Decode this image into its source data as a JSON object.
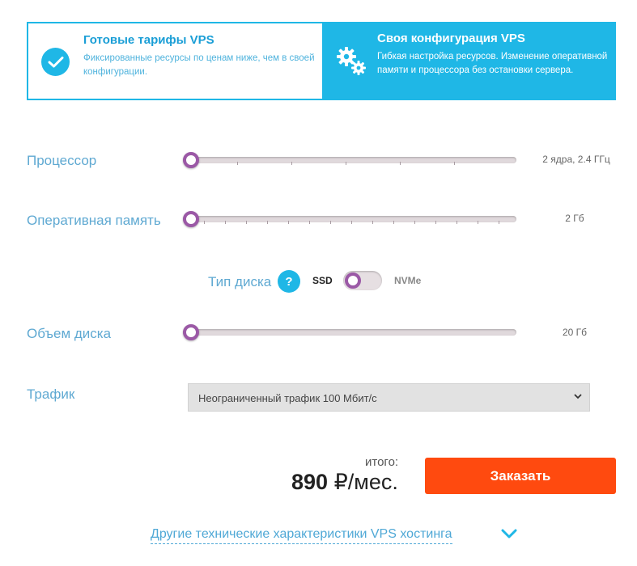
{
  "tabs": {
    "ready": {
      "title": "Готовые тарифы VPS",
      "description": "Фиксированные ресурсы по ценам ниже, чем в своей конфигурации.",
      "icon": "check-circle-icon"
    },
    "custom": {
      "title": "Своя конфигурация VPS",
      "description": "Гибкая настройка ресурсов. Изменение оперативной памяти и процессора без остановки сервера.",
      "icon": "gears-icon"
    }
  },
  "cpu": {
    "label": "Процессор",
    "value": "2 ядра, 2.4 ГГц",
    "level": 0
  },
  "ram": {
    "label": "Оперативная память",
    "value": "2 Гб",
    "level": 0
  },
  "disk_type": {
    "label": "Тип диска",
    "help": "?",
    "option_left": "SSD",
    "option_right": "NVMe",
    "selected": "SSD"
  },
  "disk": {
    "label": "Объем диска",
    "value": "20 Гб",
    "level": 0
  },
  "traffic": {
    "label": "Трафик",
    "selected": "Неограниченный трафик 100 Мбит/с"
  },
  "total": {
    "label": "итого:",
    "amount": "890",
    "unit": "₽/мес."
  },
  "order_button": "Заказать",
  "more_link": "Другие технические характеристики VPS хостинга",
  "colors": {
    "accent": "#1fb7e6",
    "handle": "#9b59a6",
    "order": "#ff4a0f",
    "label": "#5fa9d2"
  }
}
